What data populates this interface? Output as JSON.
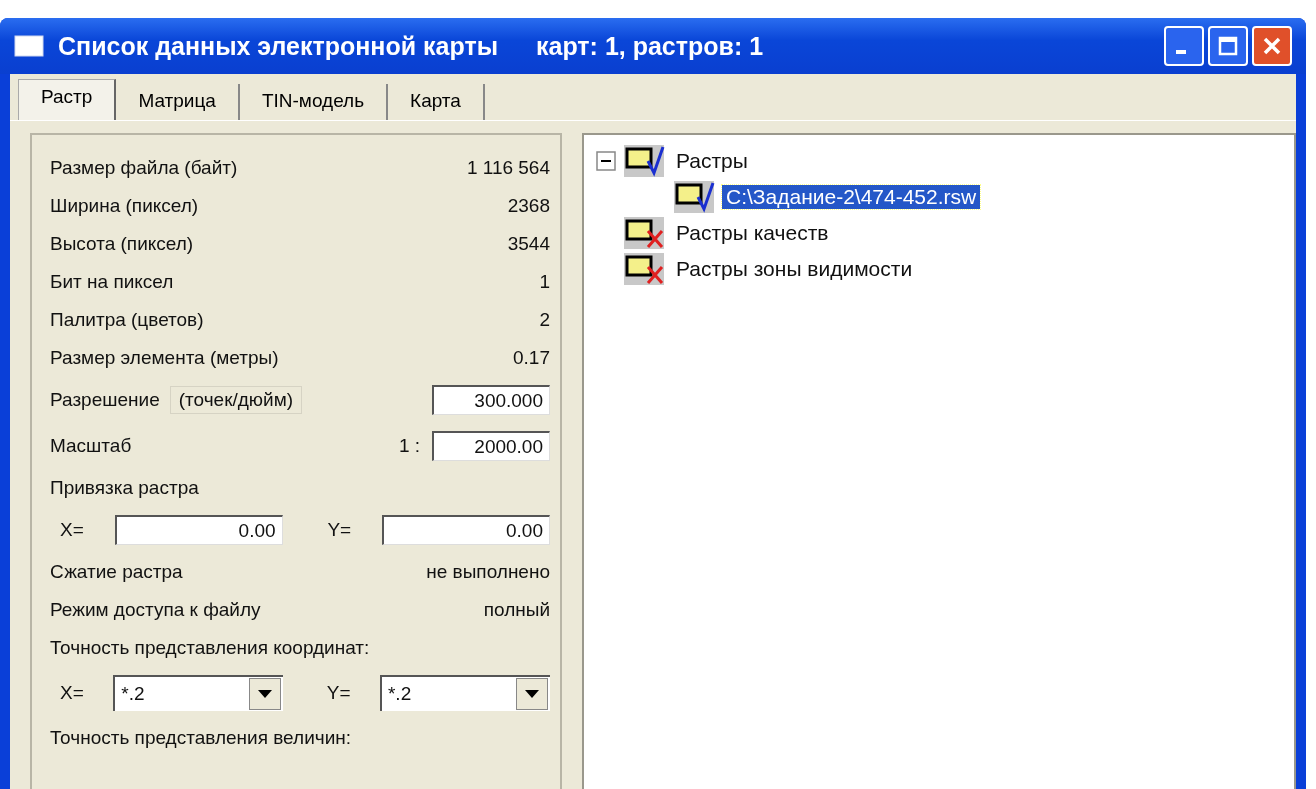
{
  "window": {
    "title": "Список данных электронной карты",
    "subtitle": "карт: 1, растров: 1"
  },
  "tabs": [
    {
      "label": "Растр",
      "selected": true
    },
    {
      "label": "Матрица",
      "selected": false
    },
    {
      "label": "TIN-модель",
      "selected": false
    },
    {
      "label": "Карта",
      "selected": false
    }
  ],
  "properties": [
    {
      "kind": "value",
      "label": "Размер файла (байт)",
      "value": "1 116 564"
    },
    {
      "kind": "value",
      "label": "Ширина (пиксел)",
      "value": "2368"
    },
    {
      "kind": "value",
      "label": "Высота (пиксел)",
      "value": "3544"
    },
    {
      "kind": "value",
      "label": "Бит на пиксел",
      "value": "1"
    },
    {
      "kind": "value",
      "label": "Палитра (цветов)",
      "value": "2"
    },
    {
      "kind": "value",
      "label": "Размер элемента (метры)",
      "value": "0.17"
    },
    {
      "kind": "unit_field",
      "label": "Разрешение",
      "unit": "(точек/дюйм)",
      "value": "300.000"
    },
    {
      "kind": "prefix_field",
      "label": "Масштаб",
      "prefix": "1 :",
      "value": "2000.00"
    },
    {
      "kind": "heading",
      "label": "Привязка растра"
    },
    {
      "kind": "field_pair",
      "fields": [
        {
          "label": "X=",
          "value": "0.00"
        },
        {
          "label": "Y=",
          "value": "0.00"
        }
      ]
    },
    {
      "kind": "value",
      "label": "Сжатие растра",
      "value": "не выполнено"
    },
    {
      "kind": "value",
      "label": "Режим доступа к файлу",
      "value": "полный"
    },
    {
      "kind": "heading",
      "label": "Точность представления координат:"
    },
    {
      "kind": "combo_pair",
      "fields": [
        {
          "label": "X=",
          "value": "*.2"
        },
        {
          "label": "Y=",
          "value": "*.2"
        }
      ]
    },
    {
      "kind": "heading",
      "label": "Точность представления величин:"
    }
  ],
  "tree": [
    {
      "label": "Растры",
      "checked": true,
      "expanded": true,
      "selected": false,
      "children": [
        {
          "label": "C:\\Задание-2\\474-452.rsw",
          "checked": true,
          "selected": true
        }
      ]
    },
    {
      "label": "Растры качеств",
      "checked": false,
      "selected": false
    },
    {
      "label": "Растры зоны видимости",
      "checked": false,
      "selected": false
    }
  ]
}
